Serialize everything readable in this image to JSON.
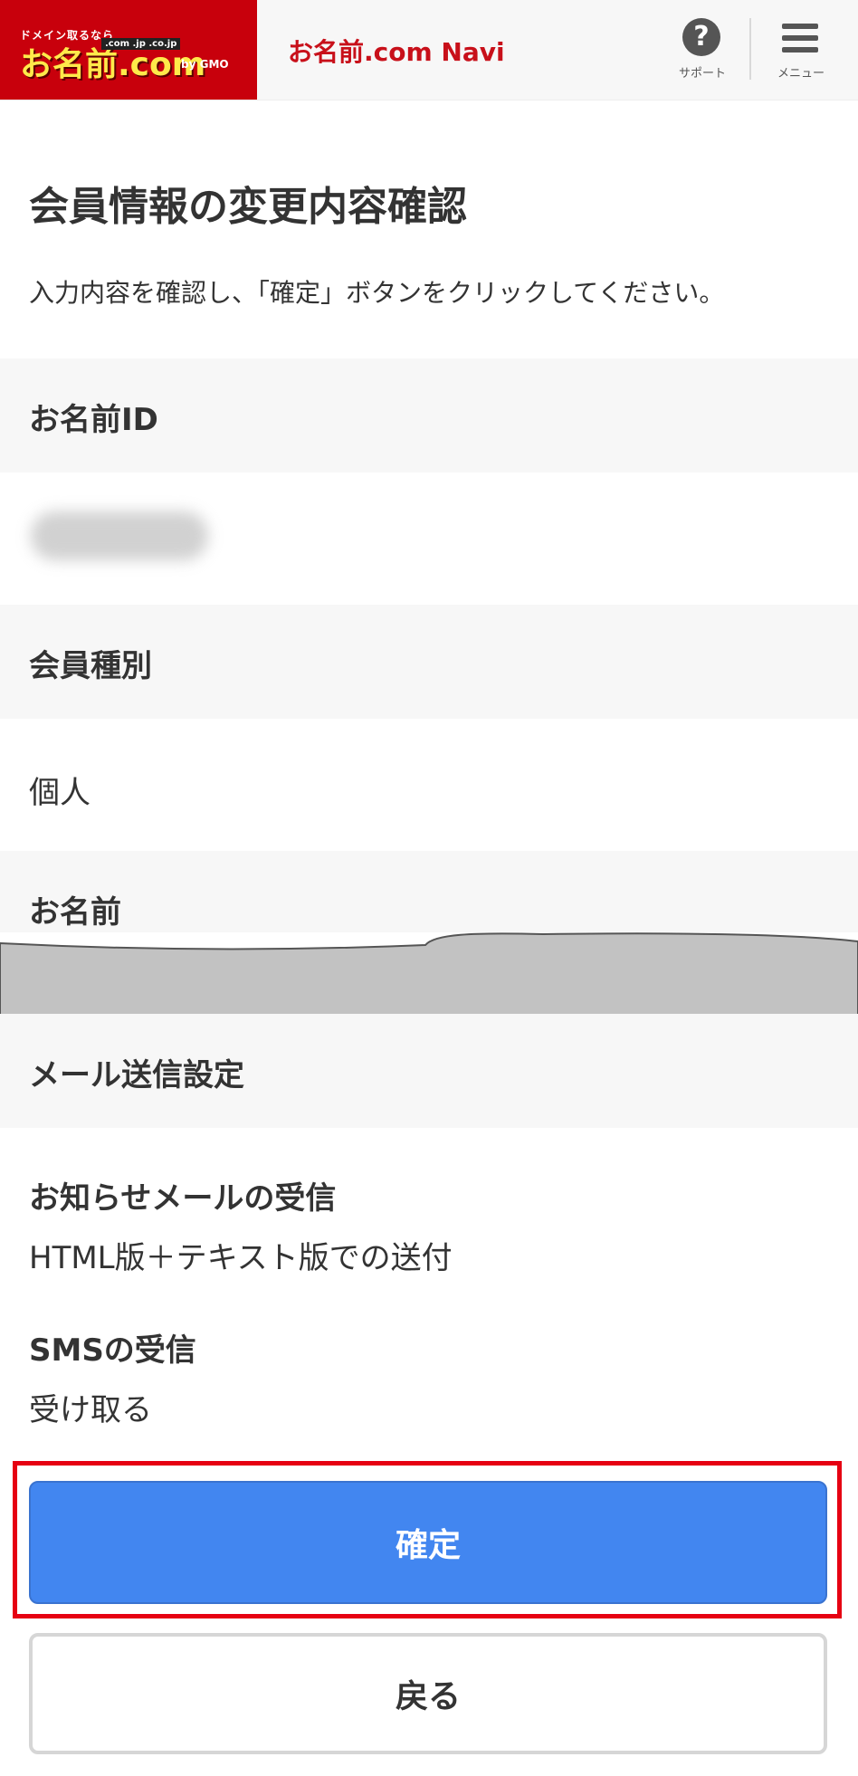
{
  "header": {
    "logo_tagline": "ドメイン取るなら",
    "logo_main": "お名前.com",
    "logo_tlds": ".com .jp .co.jp",
    "logo_by": "by GMO",
    "site_title": "お名前.com Navi",
    "support_label": "サポート",
    "menu_label": "メニュー"
  },
  "page": {
    "title": "会員情報の変更内容確認",
    "lead": "入力内容を確認し、「確定」ボタンをクリックしてください。"
  },
  "sections": {
    "member_id": {
      "label": "お名前ID",
      "value": ""
    },
    "member_type": {
      "label": "会員種別",
      "value": "個人"
    },
    "name": {
      "label": "お名前",
      "value": ""
    },
    "mail": {
      "label": "メール送信設定",
      "notice_label": "お知らせメールの受信",
      "notice_value": "HTML版＋テキスト版での送付",
      "sms_label": "SMSの受信",
      "sms_value": "受け取る"
    }
  },
  "buttons": {
    "confirm": "確定",
    "back": "戻る"
  },
  "colors": {
    "brand_red": "#c8000c",
    "primary_blue": "#4286f0",
    "highlight_red": "#e60012"
  }
}
